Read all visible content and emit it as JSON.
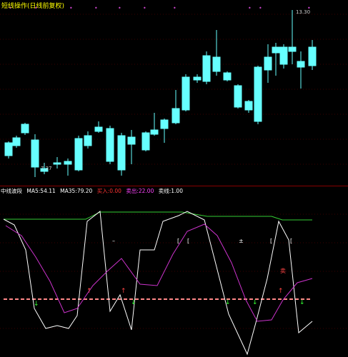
{
  "main_panel": {
    "title": "短线操作(日线前复权)",
    "title_color": "#ffff00",
    "high_label": "13.30",
    "low_label": "7.37",
    "up_color": "#ff4444",
    "down_color": "#66ffff"
  },
  "indicator_panel": {
    "name": "中线波段",
    "fields": [
      {
        "label": "MA5:",
        "value": "54.11",
        "color": "#ffffff"
      },
      {
        "label": "MA35:",
        "value": "79.20",
        "color": "#ffffff"
      },
      {
        "label": "买入:",
        "value": "0.00",
        "color": "#ff3333"
      },
      {
        "label": "卖出:",
        "value": "22.00",
        "color": "#ff44ff"
      },
      {
        "label": "卖线:",
        "value": "1.00",
        "color": "#ffffff"
      }
    ],
    "line_colors": {
      "fast": "#ffffff",
      "slow": "#cc33cc",
      "top": "#33cc33",
      "mid": "#ff8888"
    }
  }
}
